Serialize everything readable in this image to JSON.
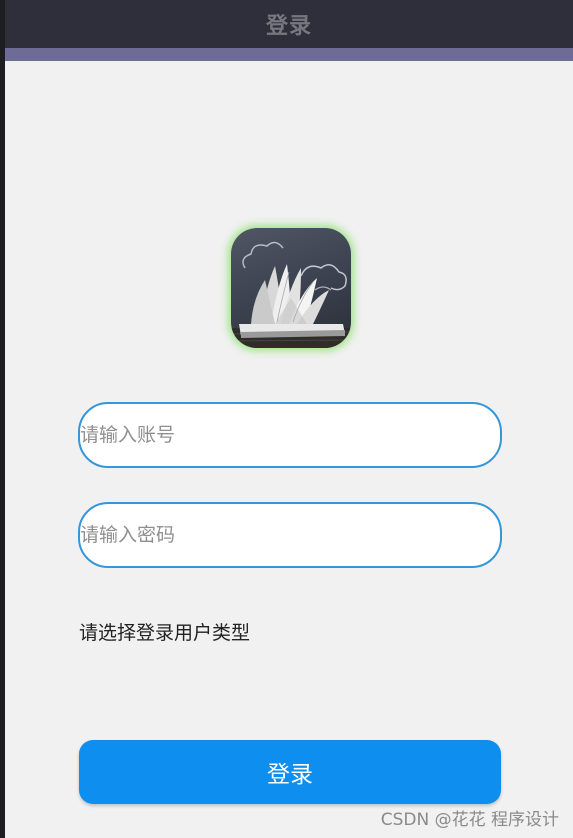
{
  "header": {
    "title": "登录"
  },
  "colors": {
    "header_bg": "#2f2f3b",
    "accent_bar": "#6e6b96",
    "input_border": "#3596d8",
    "button_bg": "#0e8eef"
  },
  "logo": {
    "icon": "open-book-icon"
  },
  "form": {
    "account_placeholder": "请输入账号",
    "password_placeholder": "请输入密码",
    "user_type_prompt": "请选择登录用户类型",
    "login_label": "登录"
  },
  "watermark": "CSDN @花花 程序设计"
}
